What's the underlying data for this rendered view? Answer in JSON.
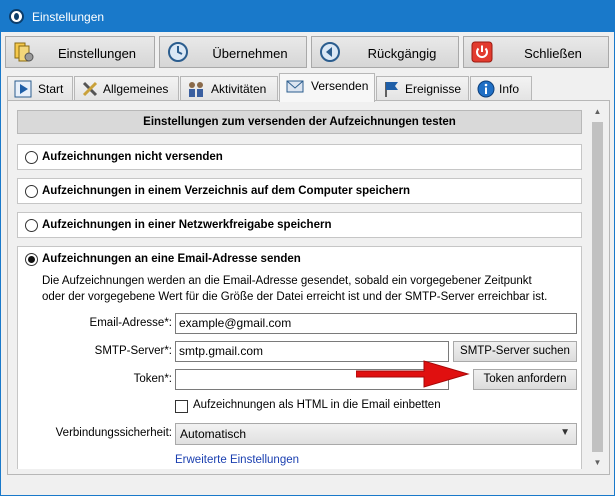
{
  "window": {
    "title": "Einstellungen"
  },
  "toolbar": {
    "settings_label": "Einstellungen",
    "apply_label": "Übernehmen",
    "undo_label": "Rückgängig",
    "close_label": "Schließen"
  },
  "tabs": [
    {
      "label": "Start",
      "icon": "play-icon"
    },
    {
      "label": "Allgemeines",
      "icon": "tools-icon"
    },
    {
      "label": "Aktivitäten",
      "icon": "people-icon"
    },
    {
      "label": "Versenden",
      "icon": "envelope-icon",
      "active": true
    },
    {
      "label": "Ereignisse",
      "icon": "flag-icon"
    },
    {
      "label": "Info",
      "icon": "info-icon"
    }
  ],
  "panel": {
    "heading": "Einstellungen zum versenden der Aufzeichnungen testen",
    "options": [
      {
        "label": "Aufzeichnungen nicht versenden",
        "checked": false
      },
      {
        "label": "Aufzeichnungen in einem Verzeichnis auf dem Computer speichern",
        "checked": false
      },
      {
        "label": "Aufzeichnungen in einer Netzwerkfreigabe speichern",
        "checked": false
      },
      {
        "label": "Aufzeichnungen an eine Email-Adresse senden",
        "checked": true
      }
    ],
    "email": {
      "description_line1": "Die Aufzeichnungen werden an die Email-Adresse gesendet, sobald ein vorgegebener Zeitpunkt",
      "description_line2": "oder der vorgegebene Wert für die Größe der Datei erreicht ist und der SMTP-Server erreichbar ist.",
      "address_label": "Email-Adresse*:",
      "address_value": "example@gmail.com",
      "smtp_label": "SMTP-Server*:",
      "smtp_value": "smtp.gmail.com",
      "smtp_button": "SMTP-Server suchen",
      "token_label": "Token*:",
      "token_value": "",
      "token_button": "Token anfordern",
      "html_checkbox_label": "Aufzeichnungen als HTML in die Email einbetten",
      "html_checked": false,
      "security_label": "Verbindungssicherheit:",
      "security_value": "Automatisch",
      "advanced_link": "Erweiterte Einstellungen"
    }
  },
  "colors": {
    "titlebar": "#1979ca",
    "link": "#1a3fb0",
    "annotation_arrow": "#e01010"
  }
}
